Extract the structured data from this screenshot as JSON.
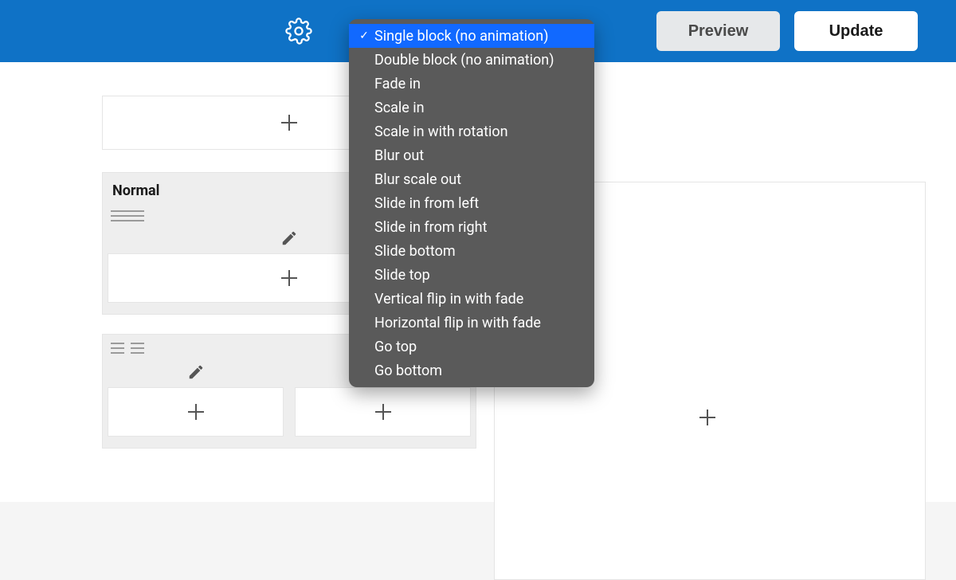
{
  "topbar": {
    "preview_label": "Preview",
    "update_label": "Update"
  },
  "group": {
    "title": "Normal"
  },
  "dropdown": {
    "selected_index": 0,
    "items": [
      "Single block (no animation)",
      "Double block (no animation)",
      "Fade in",
      "Scale in",
      "Scale in with rotation",
      "Blur out",
      "Blur scale out",
      "Slide in from left",
      "Slide in from right",
      "Slide bottom",
      "Slide top",
      "Vertical flip in with fade",
      "Horizontal flip in with fade",
      "Go top",
      "Go bottom"
    ]
  }
}
